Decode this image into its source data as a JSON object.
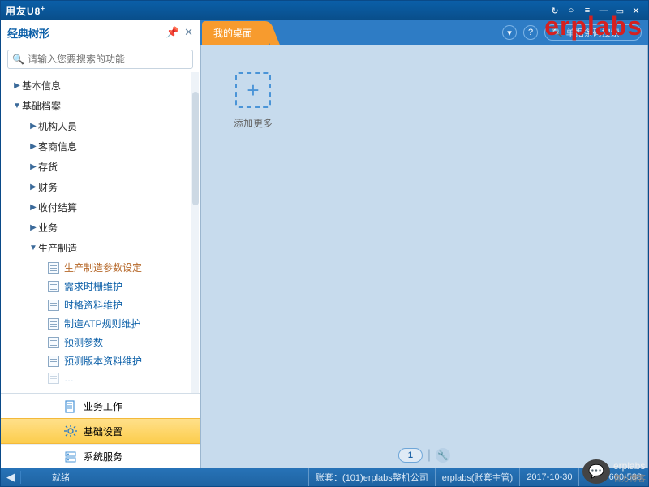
{
  "titlebar": {
    "brand_prefix": "用友",
    "brand": "U8",
    "brand_sup": "+"
  },
  "watermark": "erplabs",
  "sidebar": {
    "title": "经典树形",
    "search_placeholder": "请输入您要搜索的功能",
    "tree": {
      "n0": "基本信息",
      "n1": "基础档案",
      "n1_0": "机构人员",
      "n1_1": "客商信息",
      "n1_2": "存货",
      "n1_3": "财务",
      "n1_4": "收付结算",
      "n1_5": "业务",
      "n1_6": "生产制造",
      "leaf0": "生产制造参数设定",
      "leaf1": "需求时栅维护",
      "leaf2": "时格资料维护",
      "leaf3": "制造ATP规则维护",
      "leaf4": "预测参数",
      "leaf5": "预测版本资料维护"
    },
    "quick": {
      "q0": "业务工作",
      "q1": "基础设置",
      "q2": "系统服务"
    }
  },
  "topbar": {
    "tab0": "我的桌面",
    "help": "?",
    "search_placeholder": "单据条码搜索"
  },
  "main": {
    "add_label": "添加更多",
    "page": "1"
  },
  "status": {
    "ready": "就绪",
    "acct": "账套：(101)erplabs整机公司",
    "user": "erplabs(账套主管)",
    "date": "2017-10-30",
    "phone": "4006-600-588"
  },
  "chat": {
    "name": "erplabs",
    "sub": "官方博客"
  }
}
